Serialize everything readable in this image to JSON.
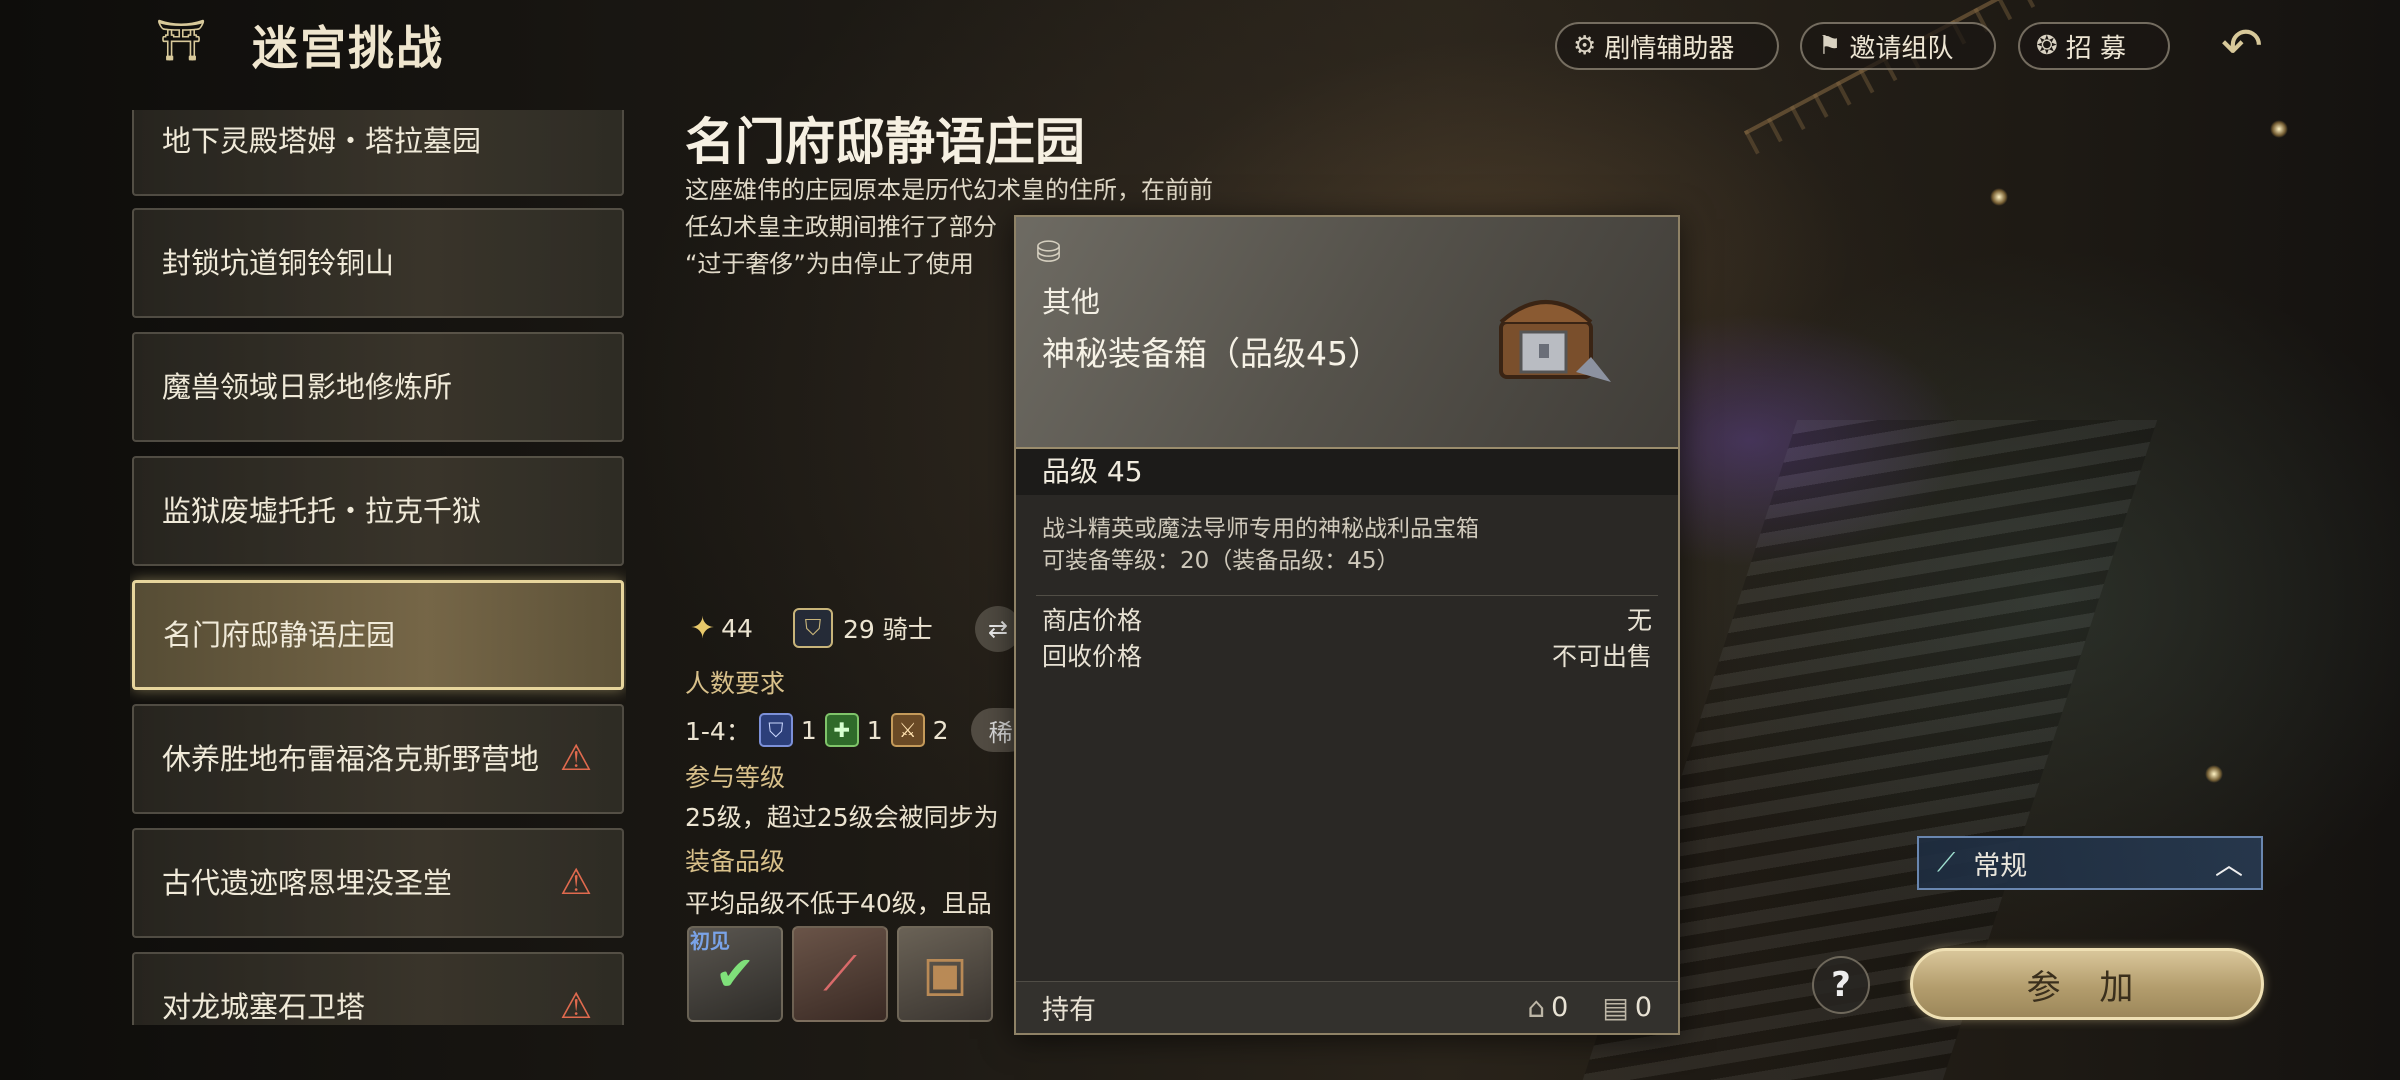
{
  "header": {
    "title": "迷宫挑战",
    "buttons": [
      {
        "label": "剧情辅助器",
        "icon": "story-helper-icon"
      },
      {
        "label": "邀请组队",
        "icon": "invite-flag-icon"
      },
      {
        "label": "招 募",
        "icon": "recruit-paw-icon"
      }
    ]
  },
  "sidebar": {
    "items": [
      {
        "label": "地下灵殿塔姆・塔拉墓园",
        "warning": false,
        "selected": false
      },
      {
        "label": "封锁坑道铜铃铜山",
        "warning": false,
        "selected": false
      },
      {
        "label": "魔兽领域日影地修炼所",
        "warning": false,
        "selected": false
      },
      {
        "label": "监狱废墟托托・拉克千狱",
        "warning": false,
        "selected": false
      },
      {
        "label": "名门府邸静语庄园",
        "warning": false,
        "selected": true
      },
      {
        "label": "休养胜地布雷福洛克斯野营地",
        "warning": true,
        "selected": false
      },
      {
        "label": "古代遗迹喀恩埋没圣堂",
        "warning": true,
        "selected": false
      },
      {
        "label": "对龙城塞石卫塔",
        "warning": true,
        "selected": false
      }
    ]
  },
  "detail": {
    "title": "名门府邸静语庄园",
    "desc_line1": "这座雄伟的庄园原本是历代幻术皇的住所，在前前",
    "desc_line2": "任幻术皇主政期间推行了部分",
    "desc_line3": "“过于奢侈”为由停止了使用",
    "stat_star": "44",
    "stat_knight": "29 骑士",
    "party_label": "人数要求",
    "party_range": "1-4：",
    "party_tank": "1",
    "party_heal": "1",
    "party_dps": "2",
    "party_pill": "稀",
    "level_label": "参与等级",
    "level_text": "25级，超过25级会被同步为",
    "gear_label": "装备品级",
    "gear_text": "平均品级不低于40级，且品",
    "first_clear": "初见"
  },
  "tooltip": {
    "category": "其他",
    "name": "神秘装备箱（品级45）",
    "grade": "品级 45",
    "desc1": "战斗精英或魔法导师专用的神秘战利品宝箱",
    "desc2": "可装备等级：20（装备品级：45）",
    "shop_label": "商店价格",
    "shop_value": "无",
    "recycle_label": "回收价格",
    "recycle_value": "不可出售",
    "hold_label": "持有",
    "home_count": "0",
    "bag_count": "0"
  },
  "controls": {
    "mode": "常规",
    "join": "参 加",
    "help": "?"
  }
}
